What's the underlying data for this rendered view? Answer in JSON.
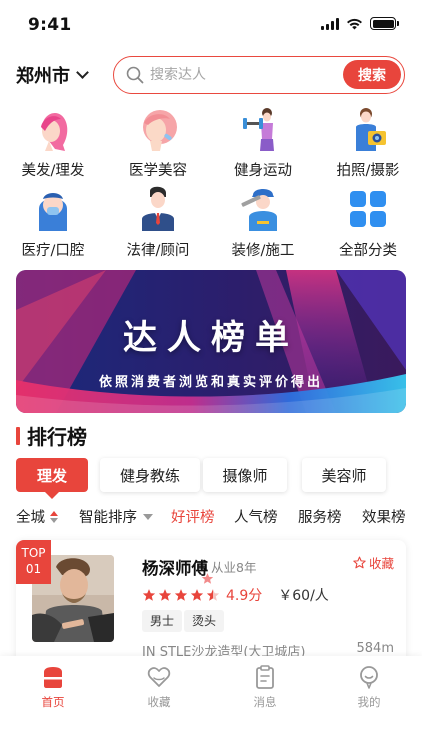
{
  "status_bar": {
    "time": "9:41"
  },
  "header": {
    "city": "郑州市",
    "search_placeholder": "搜索达人",
    "search_button": "搜索"
  },
  "categories": [
    {
      "label": "美发/理发",
      "icon": "hair-salon-icon"
    },
    {
      "label": "医学美容",
      "icon": "medical-beauty-icon"
    },
    {
      "label": "健身运动",
      "icon": "fitness-icon"
    },
    {
      "label": "拍照/摄影",
      "icon": "photography-icon"
    },
    {
      "label": "医疗/口腔",
      "icon": "dental-icon"
    },
    {
      "label": "法律/顾问",
      "icon": "lawyer-icon"
    },
    {
      "label": "装修/施工",
      "icon": "renovation-icon"
    },
    {
      "label": "全部分类",
      "icon": "grid-icon"
    }
  ],
  "banner": {
    "title": "达人榜单",
    "subtitle": "依照消费者浏览和真实评价得出"
  },
  "ranking": {
    "title": "排行榜",
    "tabs": [
      "理发",
      "健身教练",
      "摄像师",
      "美容师"
    ],
    "active_tab": "理发",
    "filters": [
      "全城",
      "智能排序",
      "好评榜",
      "人气榜",
      "服务榜",
      "效果榜"
    ],
    "active_filter": "好评榜"
  },
  "expert": {
    "badge_top": "TOP",
    "badge_rank": "01",
    "name": "杨深师傅",
    "years": "从业8年",
    "favorite_label": "收藏",
    "rating": 4.5,
    "rating_text": "4.9分",
    "price": "￥60/人",
    "tags": [
      "男士",
      "烫头"
    ],
    "shop": "IN STLE沙龙造型(大卫城店)",
    "distance": "584m"
  },
  "tab_bar": [
    {
      "label": "首页",
      "icon": "home-icon"
    },
    {
      "label": "收藏",
      "icon": "heart-icon"
    },
    {
      "label": "消息",
      "icon": "message-icon"
    },
    {
      "label": "我的",
      "icon": "profile-icon"
    }
  ],
  "colors": {
    "accent": "#e8453c",
    "text": "#222222",
    "muted": "#888888"
  }
}
